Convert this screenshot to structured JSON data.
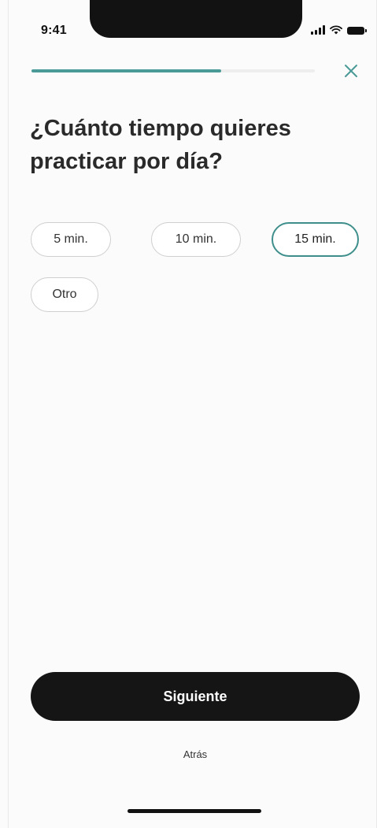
{
  "status_bar": {
    "time": "9:41",
    "icons": [
      "signal-icon",
      "wifi-icon",
      "battery-icon"
    ]
  },
  "progress": {
    "value": 0.67,
    "color": "#4a9a98"
  },
  "close_icon": "close-icon",
  "question": {
    "title": "¿Cuánto tiempo quieres practicar por día?"
  },
  "options": [
    {
      "label": "5 min.",
      "selected": false
    },
    {
      "label": "10 min.",
      "selected": false
    },
    {
      "label": "15 min.",
      "selected": true
    },
    {
      "label": "Otro",
      "selected": false
    }
  ],
  "actions": {
    "next_label": "Siguiente",
    "back_label": "Atrás"
  },
  "colors": {
    "accent": "#3e8f8c",
    "button_bg": "#151515"
  }
}
